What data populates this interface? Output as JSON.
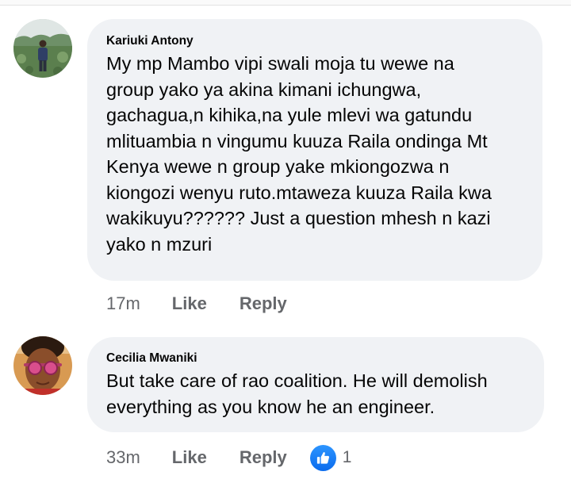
{
  "comments": [
    {
      "author": "Kariuki Antony",
      "avatar_icon": "profile-photo-person-in-field",
      "lines": [
        "My mp Mambo vipi swali moja tu wewe na",
        "group yako ya akina kimani ichungwa,",
        "gachagua,n kihika,na yule mlevi wa gatundu",
        "mlituambia n vingumu kuuza Raila ondinga Mt",
        "Kenya wewe n group yake mkiongozwa n",
        "kiongozi wenyu ruto.mtaweza kuuza Raila kwa",
        "wakikuyu?????? Just a question mhesh n kazi",
        "yako n mzuri"
      ],
      "time": "17m",
      "like_label": "Like",
      "reply_label": "Reply"
    },
    {
      "author": "Cecilia Mwaniki",
      "avatar_icon": "profile-photo-woman-with-sunglasses",
      "lines": [
        "But take care of rao coalition. He will demolish",
        "everything as you know he an engineer."
      ],
      "time": "33m",
      "like_label": "Like",
      "reply_label": "Reply",
      "reaction_icon": "thumbs-up-icon",
      "reaction_color": "#1877f2",
      "reaction_count": "1"
    }
  ]
}
